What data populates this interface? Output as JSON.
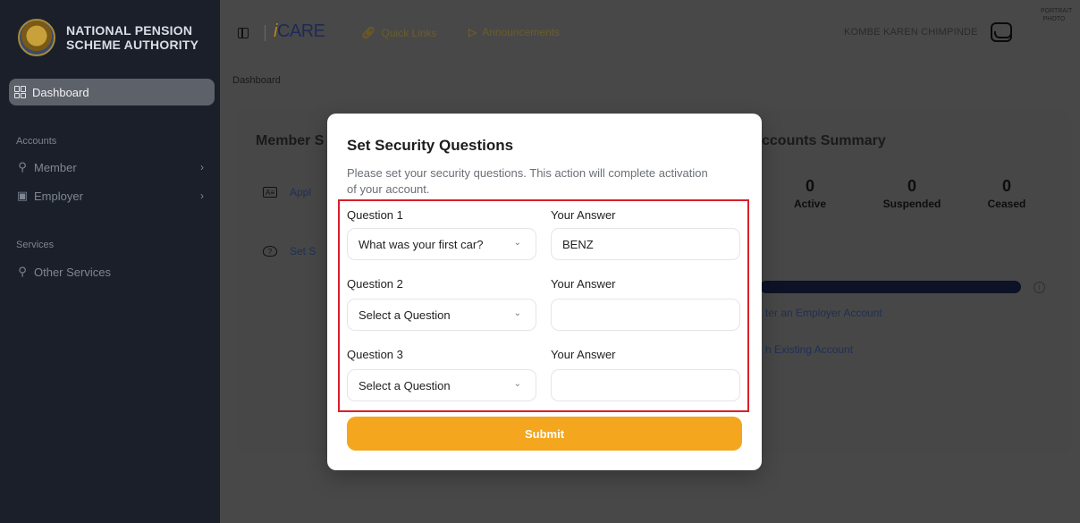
{
  "sidebar": {
    "brand_line1": "NATIONAL PENSION",
    "brand_line2": "SCHEME AUTHORITY",
    "dashboard_label": "Dashboard",
    "accounts_section": "Accounts",
    "member_label": "Member",
    "employer_label": "Employer",
    "services_section": "Services",
    "other_services_label": "Other Services"
  },
  "topbar": {
    "app_name_prefix": "i",
    "app_name": "CARE",
    "quick_links": "Quick Links",
    "announcements": "Announcements",
    "user_name": "KOMBE KAREN CHIMPINDE",
    "portrait_placeholder_line1": "PORTRAIT",
    "portrait_placeholder_line2": "PHOTO"
  },
  "main": {
    "breadcrumb": "Dashboard",
    "member_services_title": "Member S",
    "bg_item1": "Appl",
    "bg_item2": "Set S",
    "accounts_summary_title": "ccounts Summary",
    "stats": [
      {
        "num": "0",
        "label": "Active"
      },
      {
        "num": "0",
        "label": "Suspended"
      },
      {
        "num": "0",
        "label": "Ceased"
      }
    ],
    "link_register": "ter an Employer Account",
    "link_existing": "h Existing Account"
  },
  "modal": {
    "title": "Set Security Questions",
    "description": "Please set your security questions. This action will complete activation of your account.",
    "question1_label": "Question 1",
    "question2_label": "Question 2",
    "question3_label": "Question 3",
    "answer_label": "Your Answer",
    "question1_value": "What was your first car?",
    "question2_value": "Select a Question",
    "question3_value": "Select a Question",
    "answer1_value": "BENZ",
    "answer2_value": "",
    "answer3_value": "",
    "submit_label": "Submit"
  },
  "colors": {
    "accent": "#f4a61e",
    "highlight": "#d8202a"
  }
}
